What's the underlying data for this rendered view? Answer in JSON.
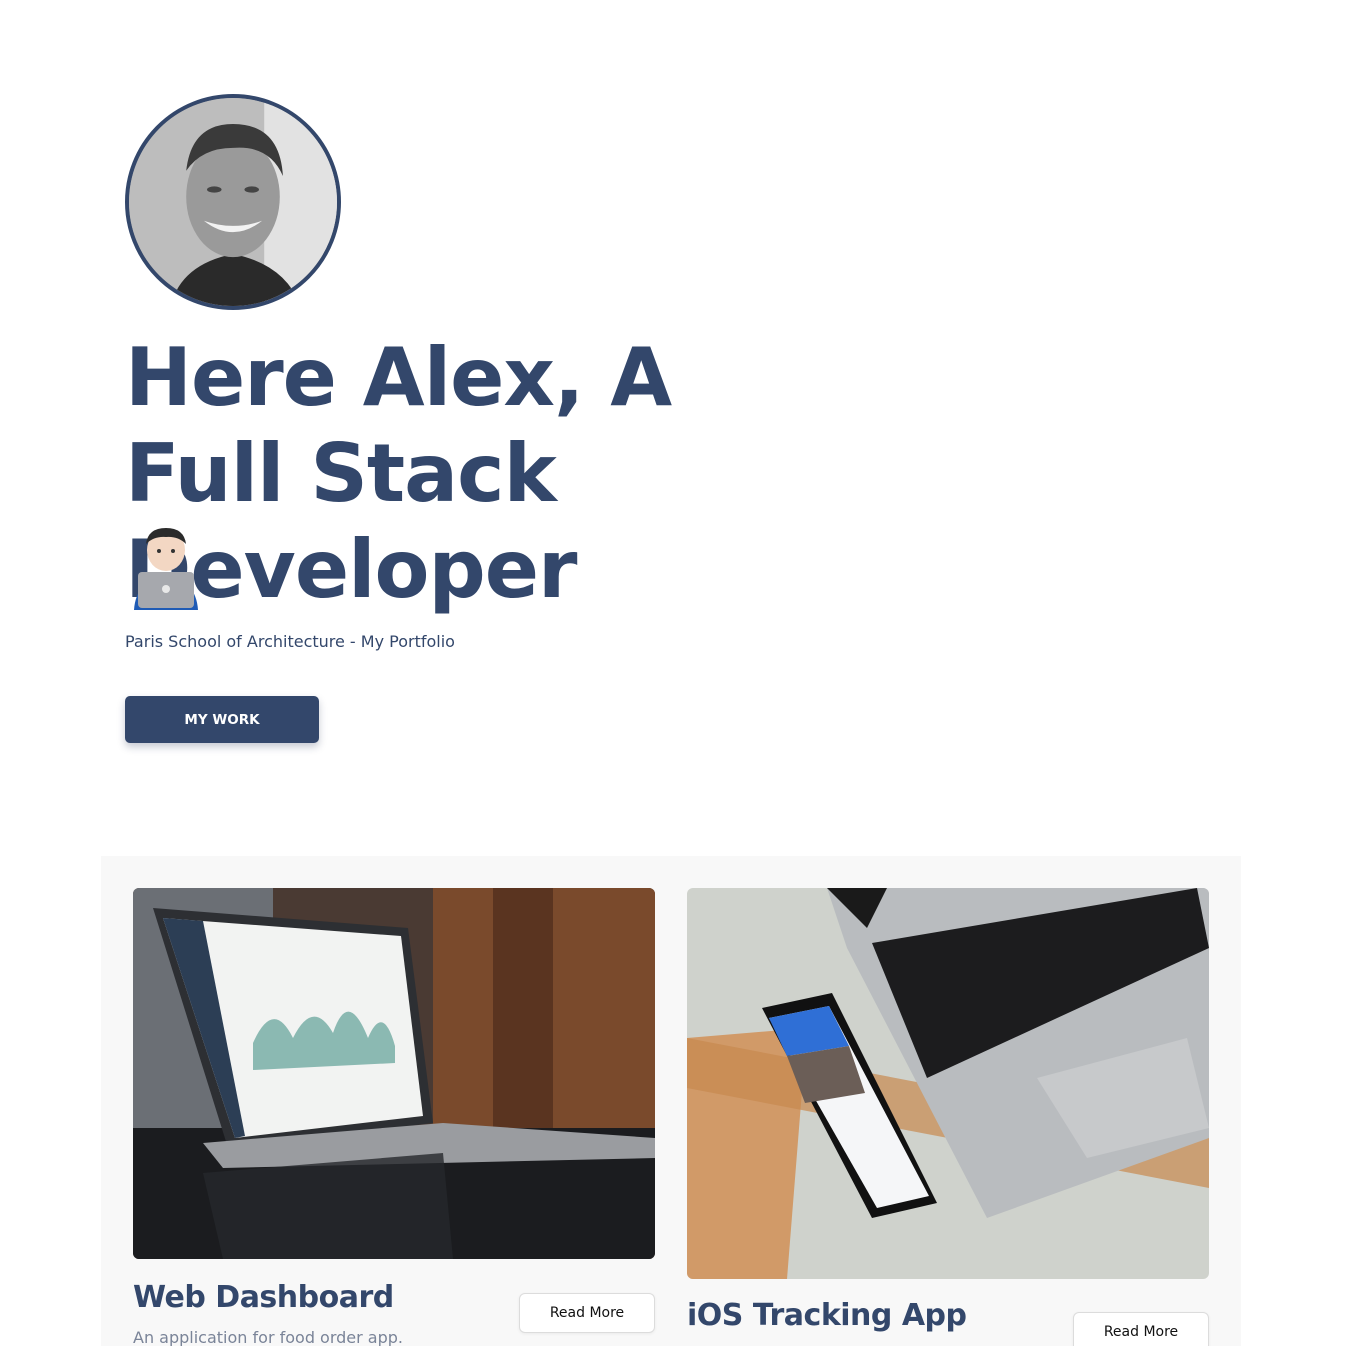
{
  "hero": {
    "avatar_icon": "profile-photo",
    "title": "Here Alex, A Full Stack Developer",
    "emoji_icon": "technologist-emoji",
    "subtitle": "Paris School of Architecture - My Portfolio",
    "cta_label": "MY WORK"
  },
  "projects": [
    {
      "image_icon": "laptop-dashboard-photo",
      "title": "Web Dashboard",
      "description": "An application for food order app.",
      "button_label": "Read More"
    },
    {
      "image_icon": "phone-laptop-photo",
      "title": "iOS Tracking App",
      "button_label": "Read More"
    }
  ],
  "colors": {
    "primary": "#33476b",
    "section_bg": "#f8f8f8",
    "muted_text": "#7a8498"
  }
}
